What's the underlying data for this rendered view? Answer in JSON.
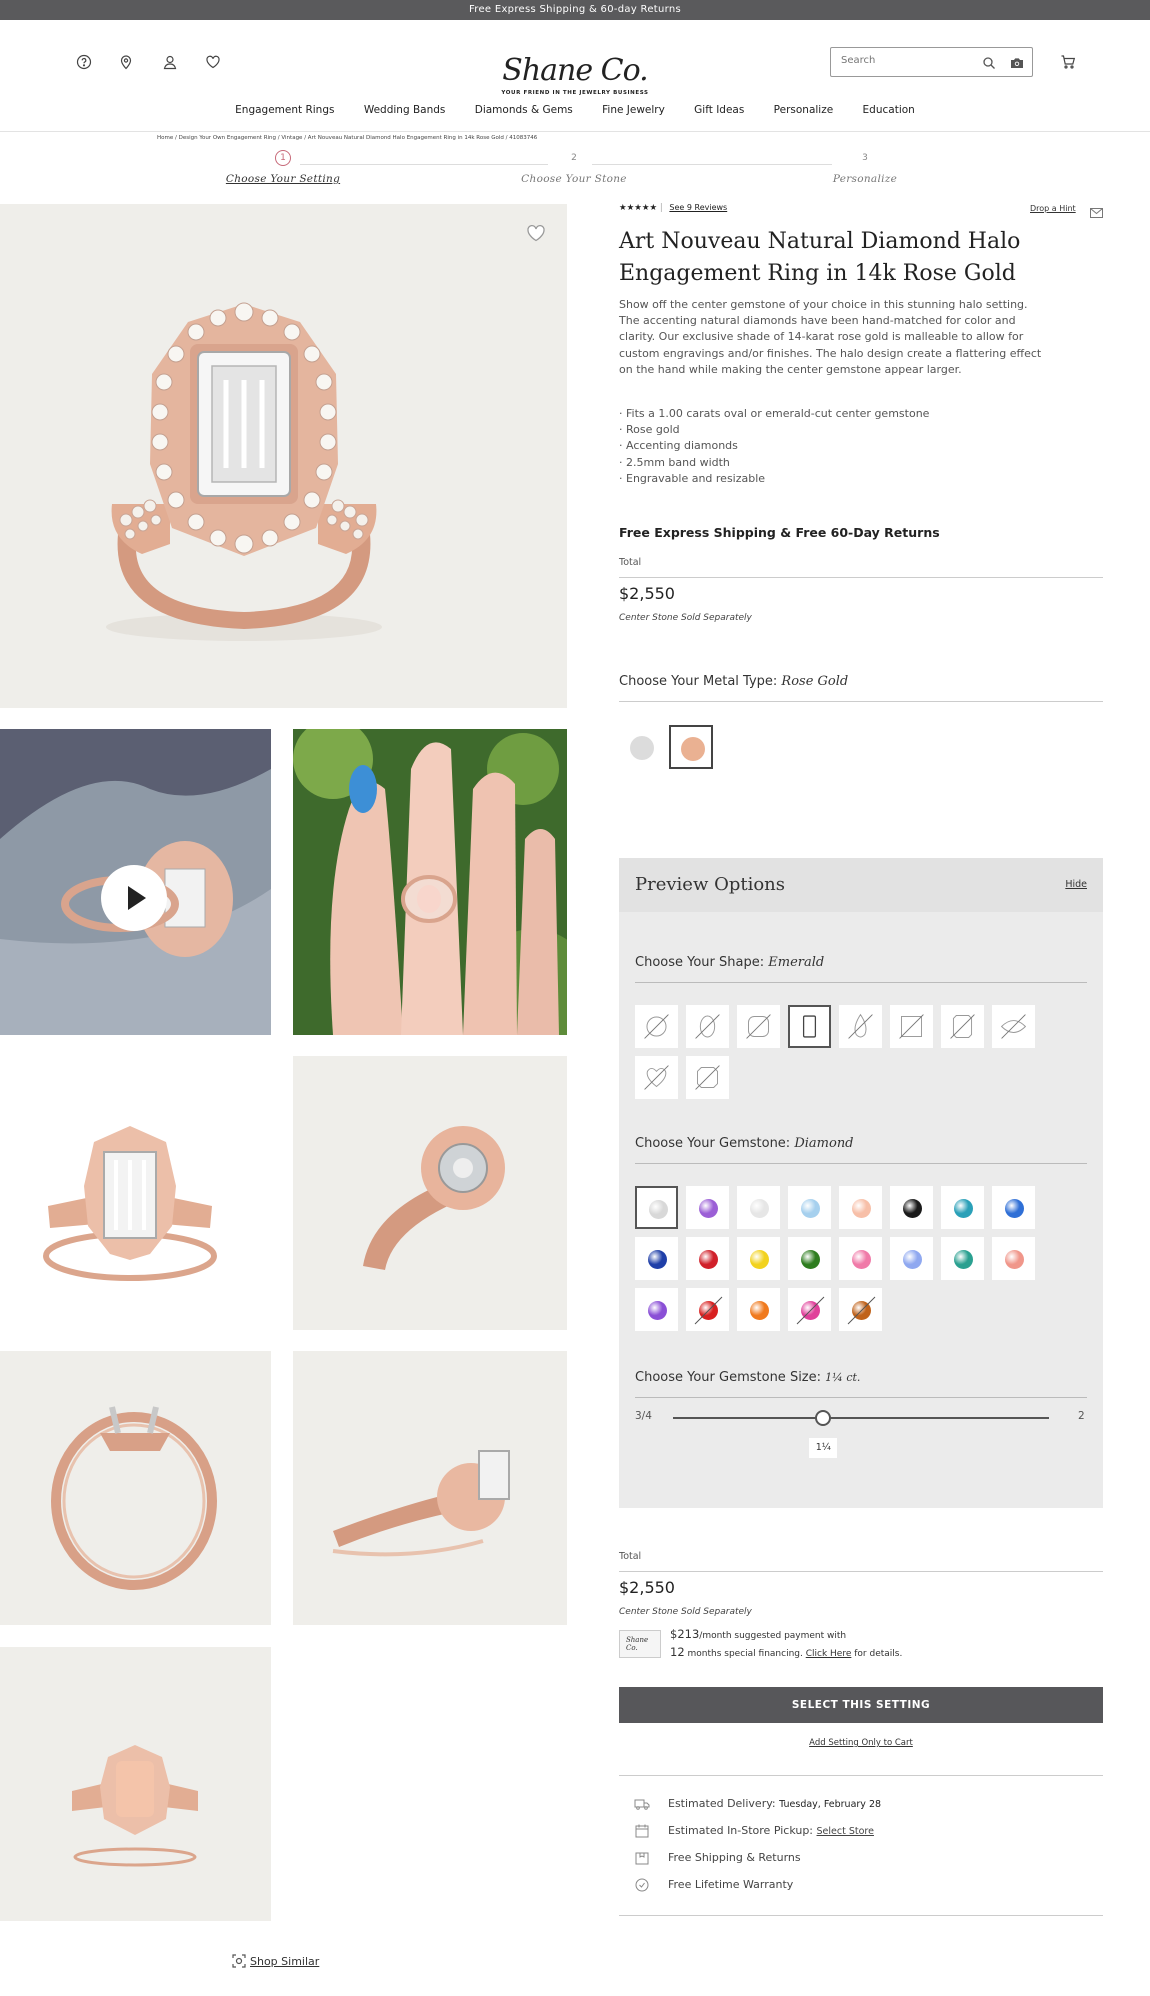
{
  "topbar": {
    "text": "Free Express Shipping & 60-day Returns"
  },
  "header": {
    "logo_name": "Shane Co.",
    "logo_tagline": "YOUR FRIEND IN THE JEWELRY BUSINESS",
    "search_placeholder": "Search",
    "icons": [
      "help-icon",
      "location-icon",
      "account-icon",
      "heart-icon",
      "search-icon",
      "camera-icon",
      "cart-icon"
    ]
  },
  "nav": {
    "items": [
      "Engagement Rings",
      "Wedding Bands",
      "Diamonds & Gems",
      "Fine Jewelry",
      "Gift Ideas",
      "Personalize",
      "Education"
    ]
  },
  "breadcrumb": "Home / Design Your Own Engagement Ring / Vintage / Art Nouveau Natural Diamond Halo Engagement Ring in 14k Rose Gold / 41083746",
  "steps": [
    {
      "num": "1",
      "label": "Choose Your Setting"
    },
    {
      "num": "2",
      "label": "Choose Your Stone"
    },
    {
      "num": "3",
      "label": "Personalize"
    }
  ],
  "product": {
    "stars": "★★★★★",
    "reviews_link": "See 9 Reviews",
    "drop_hint": "Drop a Hint",
    "title": "Art Nouveau Natural Diamond Halo Engagement Ring in 14k Rose Gold",
    "description": "Show off the center gemstone of your choice in this stunning halo setting. The accenting natural diamonds have been hand-matched for color and clarity. Our exclusive shade of 14-karat rose gold is malleable to allow for custom engravings and/or finishes. The halo design create a flattering effect on the hand while making the center gemstone appear larger.",
    "bullets": [
      "· Fits a 1.00 carats oval or emerald-cut center gemstone",
      "· Rose gold",
      "· Accenting diamonds",
      "· 2.5mm band width",
      "· Engravable and resizable"
    ],
    "shipping": "Free Express Shipping & Free 60-Day Returns",
    "total_label": "Total",
    "price": "$2,550",
    "stone_separately": "Center Stone Sold Separately"
  },
  "metal": {
    "label": "Choose Your Metal Type:",
    "selected": "Rose Gold",
    "options": [
      {
        "name": "white-gold",
        "color": "#dcdcdc"
      },
      {
        "name": "rose-gold",
        "color": "#eab192"
      }
    ]
  },
  "preview": {
    "title": "Preview Options",
    "hide": "Hide",
    "shape_label": "Choose Your Shape:",
    "shape_selected": "Emerald",
    "shapes": [
      "round",
      "oval",
      "cushion",
      "emerald",
      "pear",
      "princess",
      "radiant",
      "marquise",
      "heart",
      "asscher"
    ],
    "gem_label": "Choose Your Gemstone:",
    "gem_selected": "Diamond",
    "gems": [
      {
        "name": "diamond",
        "color": "#d8d8d8",
        "sel": true
      },
      {
        "name": "purple",
        "color": "#9b5fd6"
      },
      {
        "name": "white",
        "color": "#e6e6e6"
      },
      {
        "name": "light-blue",
        "color": "#a6d0ee"
      },
      {
        "name": "peach",
        "color": "#f7bfa8"
      },
      {
        "name": "black",
        "color": "#1a1a1a"
      },
      {
        "name": "teal",
        "color": "#2aa0b8"
      },
      {
        "name": "blue",
        "color": "#2f6fd6"
      },
      {
        "name": "dark-blue",
        "color": "#1f3fa8"
      },
      {
        "name": "red",
        "color": "#d0202a"
      },
      {
        "name": "yellow",
        "color": "#f2d21e"
      },
      {
        "name": "green",
        "color": "#2e7d1f"
      },
      {
        "name": "pink",
        "color": "#f07aa8"
      },
      {
        "name": "periwinkle",
        "color": "#8fa8f0"
      },
      {
        "name": "sea-green",
        "color": "#2aa090"
      },
      {
        "name": "coral",
        "color": "#f0968a"
      },
      {
        "name": "violet",
        "color": "#8a4fd6",
        "na": false
      },
      {
        "name": "ruby",
        "color": "#d82020",
        "na": true
      },
      {
        "name": "orange",
        "color": "#f07a1e"
      },
      {
        "name": "hot-pink",
        "color": "#e0409a",
        "na": true
      },
      {
        "name": "cognac",
        "color": "#c0621a",
        "na": true
      }
    ],
    "size_label": "Choose Your Gemstone Size:",
    "size_selected": "1¼ ct.",
    "size_min": "3/4",
    "size_max": "2",
    "size_value_label": "1¼",
    "size_fraction": 0.4
  },
  "total2": {
    "label": "Total",
    "price": "$2,550",
    "stone_separately": "Center Stone Sold Separately"
  },
  "finance": {
    "card": "Shane Co.",
    "amount": "$213",
    "per_month": "/month suggested payment with",
    "months": "12",
    "months_text": " months special financing.",
    "click_here": "Click Here",
    "details": " for details."
  },
  "buttons": {
    "select": "SELECT THIS SETTING",
    "add_to_cart": "Add Setting Only to Cart"
  },
  "info": {
    "delivery_label": "Estimated Delivery:",
    "delivery_date": "Tuesday, February 28",
    "pickup_label": "Estimated In-Store Pickup:",
    "select_store": "Select Store",
    "free_shipping": "Free Shipping & Returns",
    "warranty": "Free Lifetime Warranty"
  },
  "shop_similar": "Shop Similar"
}
